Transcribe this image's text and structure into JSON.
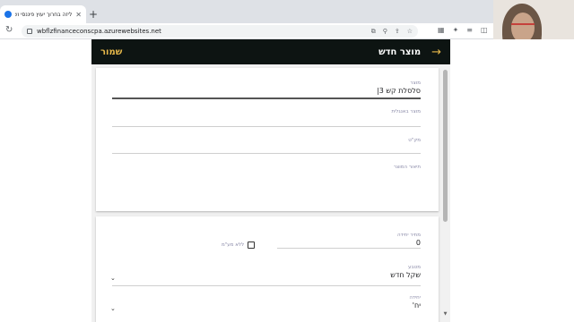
{
  "browser": {
    "tab_title": "ליזה בחרוך יעוץ פיננסי ושירותי",
    "tab_close": "✕",
    "new_tab": "+",
    "url": "wbflzfinanceconscpa.azurewebsites.net"
  },
  "icons": {
    "reload": "↻",
    "back": "→",
    "omnibox": [
      "⧉",
      "⚲",
      "⇪",
      "☆"
    ],
    "toolbar": [
      "▦",
      "✦",
      "≡",
      "◫"
    ]
  },
  "appbar": {
    "title": "מוצר חדש",
    "save_label": "שמור"
  },
  "form": {
    "product": {
      "label": "מוצר",
      "value": "סלסלת קש 3|"
    },
    "product_foreign": {
      "label": "מוצר באנגלית",
      "value": ""
    },
    "sku": {
      "label": "מק\"ט",
      "value": ""
    },
    "description": {
      "label": "תיאור המוצר",
      "value": ""
    },
    "unit_price": {
      "label": "מחיר יחידה",
      "value": "0"
    },
    "no_vat": {
      "label": "ללא מע\"מ",
      "checked": false
    },
    "currency": {
      "label": "מטבע",
      "value": "שקל חדש"
    },
    "unit": {
      "label": "יחידה",
      "value": "יח'"
    }
  },
  "colors": {
    "appbar_bg": "#0d1412",
    "accent": "#e6b84a",
    "label": "#8a8aa8"
  }
}
